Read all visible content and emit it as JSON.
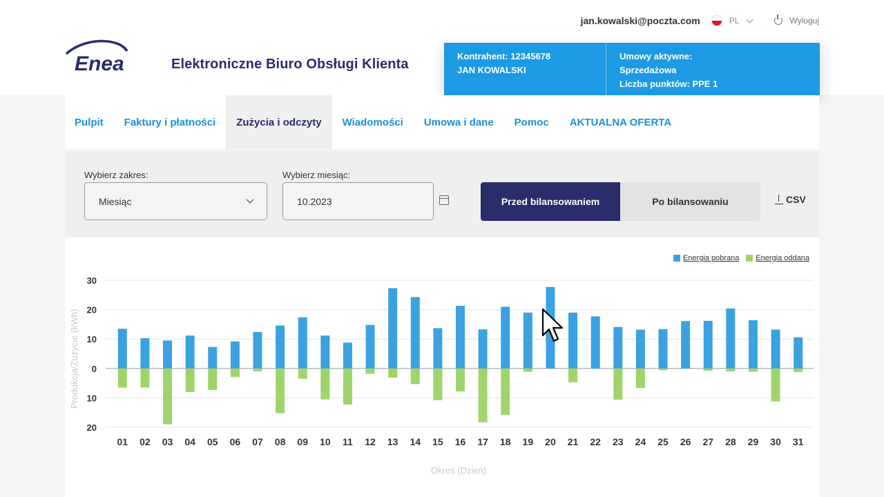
{
  "header": {
    "logo_text": "Enea",
    "app_title": "Elektroniczne Biuro Obsługi Klienta",
    "user_email": "jan.kowalski@poczta.com",
    "language": "PL",
    "logout_label": "Wyloguj"
  },
  "client": {
    "contractor": "Kontrahent: 12345678",
    "name": "JAN KOWALSKI",
    "contracts_label": "Umowy aktywne:",
    "contract_type": "Sprzedażowa",
    "points": "Liczba punktów: PPE 1"
  },
  "nav": {
    "items": [
      "Pulpit",
      "Faktury i płatności",
      "Zużycia i odczyty",
      "Wiadomości",
      "Umowa i dane",
      "Pomoc",
      "AKTUALNA OFERTA"
    ],
    "active": "Zużycia i odczyty"
  },
  "filters": {
    "range_label": "Wybierz zakres:",
    "range_value": "Miesiąc",
    "month_label": "Wybierz miesiąc:",
    "month_value": "10.2023",
    "toggle_on": "Przed bilansowaniem",
    "toggle_off": "Po bilansowaniu",
    "csv_label": "CSV"
  },
  "colors": {
    "accent": "#1c9ae3",
    "navy": "#2a2d6b",
    "pobrana": "#3aa2e0",
    "oddana": "#9fd46b"
  },
  "chart_data": {
    "type": "bar",
    "xlabel": "Okres (Dzień)",
    "ylabel": "Produkcja/Zużycie (kWh)",
    "y_ticks": [
      "30",
      "20",
      "10",
      "0",
      "10",
      "20"
    ],
    "ylim": [
      -20,
      30
    ],
    "categories": [
      "01",
      "02",
      "03",
      "04",
      "05",
      "06",
      "07",
      "08",
      "09",
      "10",
      "11",
      "12",
      "13",
      "14",
      "15",
      "16",
      "17",
      "18",
      "19",
      "20",
      "21",
      "22",
      "23",
      "24",
      "25",
      "26",
      "27",
      "28",
      "29",
      "30",
      "31"
    ],
    "legend_position": "top-right",
    "series": [
      {
        "name": "Energia pobrana",
        "values": [
          13.5,
          10.3,
          9.5,
          11.2,
          7.3,
          9.2,
          12.4,
          14.6,
          17.4,
          11.2,
          8.8,
          14.8,
          27.3,
          24.3,
          13.7,
          21.3,
          13.3,
          21.0,
          19.0,
          27.7,
          19.0,
          17.7,
          14.1,
          13.2,
          13.4,
          16.1,
          16.2,
          20.4,
          16.4,
          13.2,
          10.6
        ]
      },
      {
        "name": "Energia oddana",
        "values": [
          -6.5,
          -6.5,
          -19.0,
          -8.0,
          -7.3,
          -2.9,
          -1.0,
          -15.2,
          -3.5,
          -10.5,
          -12.3,
          -1.8,
          -3.1,
          -5.3,
          -10.8,
          -7.8,
          -18.3,
          -15.8,
          -1.1,
          0,
          -4.7,
          0,
          -10.6,
          -6.6,
          -0.6,
          0,
          -0.8,
          -1.0,
          -1.1,
          -11.2,
          -1.2
        ]
      }
    ]
  }
}
